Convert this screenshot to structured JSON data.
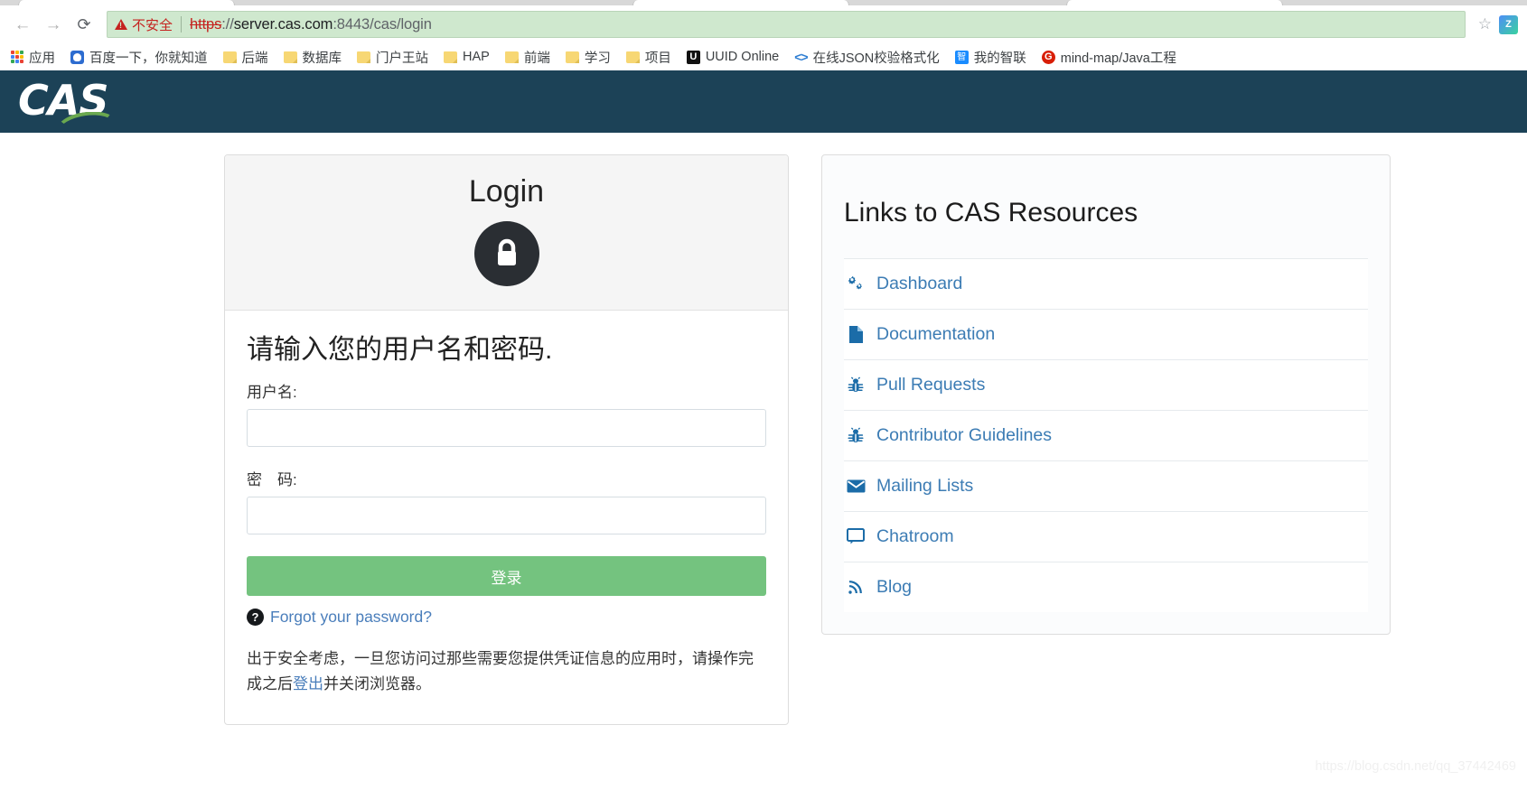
{
  "browser": {
    "nav": {
      "back": "←",
      "forward": "→",
      "reload": "⟳"
    },
    "omnibox": {
      "security_label": "不安全",
      "url_scheme": "https",
      "url_rest_separator": "://",
      "url_host": "server.cas.com",
      "url_path": ":8443/cas/login",
      "star": "☆",
      "extension_badge": "Z"
    },
    "bookmarks": [
      {
        "label": "应用",
        "icon": "apps-grid-icon"
      },
      {
        "label": "百度一下，你就知道",
        "icon": "baidu-icon"
      },
      {
        "label": "后端",
        "icon": "folder-icon"
      },
      {
        "label": "数据库",
        "icon": "folder-icon"
      },
      {
        "label": "门户王站",
        "icon": "folder-icon"
      },
      {
        "label": "HAP",
        "icon": "folder-icon"
      },
      {
        "label": "前端",
        "icon": "folder-icon"
      },
      {
        "label": "学习",
        "icon": "folder-icon"
      },
      {
        "label": "项目",
        "icon": "folder-icon"
      },
      {
        "label": "UUID Online",
        "icon": "uuid-icon"
      },
      {
        "label": "在线JSON校验格式化",
        "icon": "json-code-icon"
      },
      {
        "label": "我的智联",
        "icon": "zhilian-icon"
      },
      {
        "label": "mind-map/Java工程",
        "icon": "gitee-icon"
      }
    ]
  },
  "cas": {
    "brand": "CAS",
    "login": {
      "title": "Login",
      "lock_icon": "lock-icon",
      "form_heading": "请输入您的用户名和密码.",
      "username_label": "用户名:",
      "username_value": "",
      "username_placeholder": "",
      "password_label": "密　码:",
      "password_value": "",
      "password_placeholder": "",
      "submit_label": "登录",
      "forgot_label": "Forgot your password?",
      "notice_before": "出于安全考虑，一旦您访问过那些需要您提供凭证信息的应用时，请操作完成之后",
      "notice_link": "登出",
      "notice_after": "并关闭浏览器。"
    },
    "resources": {
      "title": "Links to CAS Resources",
      "items": [
        {
          "label": "Dashboard",
          "icon": "cogs-icon"
        },
        {
          "label": "Documentation",
          "icon": "file-icon"
        },
        {
          "label": "Pull Requests",
          "icon": "bug-icon"
        },
        {
          "label": "Contributor Guidelines",
          "icon": "bug-icon"
        },
        {
          "label": "Mailing Lists",
          "icon": "envelope-icon"
        },
        {
          "label": "Chatroom",
          "icon": "comment-icon"
        },
        {
          "label": "Blog",
          "icon": "rss-icon"
        }
      ]
    }
  },
  "watermark": "https://blog.csdn.net/qq_37442469",
  "colors": {
    "header_navy": "#1c4257",
    "logo_green": "#6aa84f",
    "button_green": "#74c37f",
    "link_blue": "#3c7cb4",
    "insecure_red": "#c5221f",
    "omnibox_green": "#cfe8ce"
  }
}
